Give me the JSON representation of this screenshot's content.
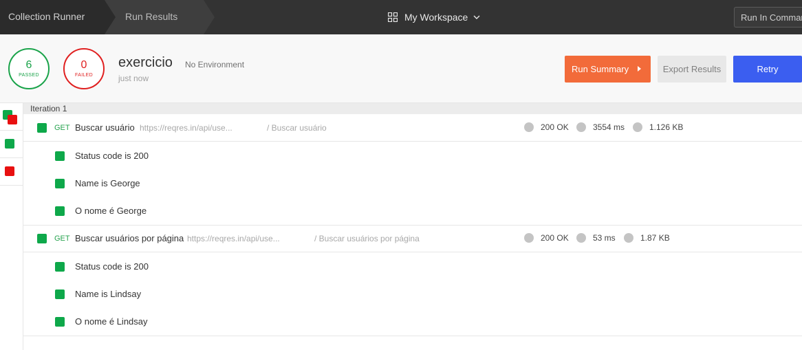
{
  "topbar": {
    "crumb_runner": "Collection Runner",
    "crumb_results": "Run Results",
    "workspace": "My Workspace",
    "run_command": "Run In Command Line"
  },
  "summary": {
    "passed_count": "6",
    "passed_label": "PASSED",
    "failed_count": "0",
    "failed_label": "FAILED",
    "collection_name": "exercicio",
    "environment": "No Environment",
    "time": "just now",
    "run_summary_label": "Run Summary",
    "export_label": "Export Results",
    "retry_label": "Retry"
  },
  "iteration_label": "Iteration 1",
  "requests": [
    {
      "method": "GET",
      "name": "Buscar usuário",
      "url": "https://reqres.in/api/use...",
      "path": "/ Buscar usuário",
      "status": "200 OK",
      "time": "3554 ms",
      "size": "1.126 KB",
      "tests": [
        "Status code is 200",
        "Name is George",
        "O nome é George"
      ]
    },
    {
      "method": "GET",
      "name": "Buscar usuários por página",
      "url": "https://reqres.in/api/use...",
      "path": "/ Buscar usuários por página",
      "status": "200 OK",
      "time": "53 ms",
      "size": "1.87 KB",
      "tests": [
        "Status code is 200",
        "Name is Lindsay",
        "O nome é Lindsay"
      ]
    }
  ],
  "colors": {
    "pass": "#0ea84a",
    "fail": "#e81010",
    "accent_orange": "#f26b3a",
    "accent_blue": "#3b5ef0"
  }
}
